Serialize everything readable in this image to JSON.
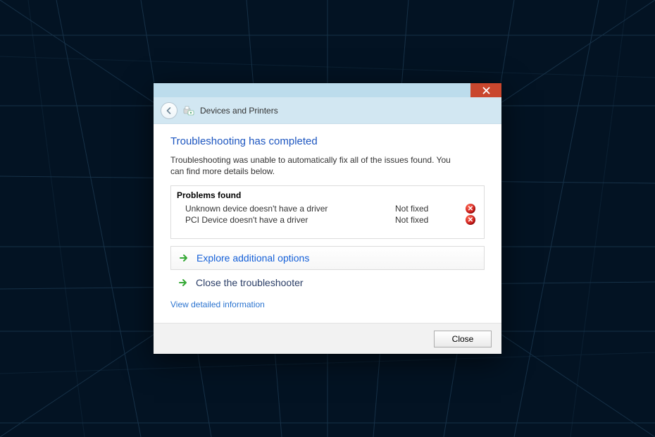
{
  "header": {
    "title": "Devices and Printers"
  },
  "main": {
    "completed_title": "Troubleshooting has completed",
    "summary": "Troubleshooting was unable to automatically fix all of the issues found. You can find more details below.",
    "problems_heading": "Problems found",
    "problems": [
      {
        "name": "Unknown device doesn't have a driver",
        "status": "Not fixed"
      },
      {
        "name": "PCI Device doesn't have a driver",
        "status": "Not fixed"
      }
    ],
    "explore_label": "Explore additional options",
    "close_ts_label": "Close the troubleshooter",
    "detail_link": "View detailed information"
  },
  "footer": {
    "close_label": "Close"
  }
}
